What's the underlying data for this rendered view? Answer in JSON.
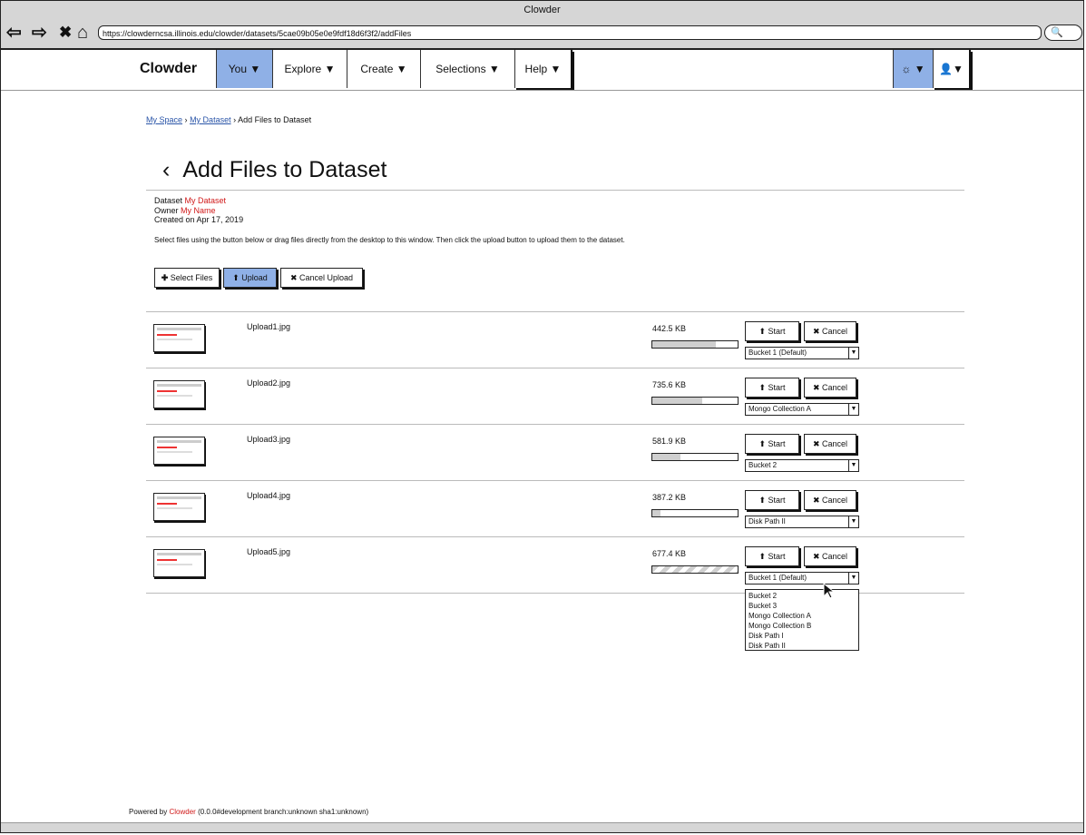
{
  "window": {
    "title": "Clowder"
  },
  "browser": {
    "url": "https://clowderncsa.illinois.edu/clowder/datasets/5cae09b05e0e9fdf18d6f3f2/addFiles",
    "search_icon": "search-icon"
  },
  "navbar": {
    "brand": "Clowder",
    "menus": [
      {
        "label": "You ▼"
      },
      {
        "label": "Explore ▼"
      },
      {
        "label": "Create ▼"
      },
      {
        "label": "Selections ▼"
      },
      {
        "label": "Help ▼"
      }
    ],
    "right_items": [
      {
        "label": "☼ ▼"
      },
      {
        "label": "👤▼"
      }
    ],
    "accent_color": "#8fb0e6"
  },
  "breadcrumb": {
    "items": [
      "My Space",
      "My Dataset"
    ],
    "separator": "›",
    "current": "Add Files to Dataset"
  },
  "page": {
    "back_icon": "‹",
    "title": "Add Files to Dataset",
    "dataset_label": "Dataset",
    "dataset_value": "My Dataset",
    "owner_label": "Owner",
    "owner_value": "My Name",
    "created": "Created on Apr 17, 2019",
    "instructions": "Select files using the button below or drag files directly from the desktop to this window. Then click the upload button to upload them to the dataset."
  },
  "toolbar": {
    "select_files": "Select Files",
    "upload": "Upload",
    "cancel_upload": "Cancel Upload"
  },
  "files": [
    {
      "name": "Upload1.jpg",
      "size": "442.5 KB",
      "progress": 0.74,
      "start": "Start",
      "cancel": "Cancel",
      "storage": "Bucket 1 (Default)"
    },
    {
      "name": "Upload2.jpg",
      "size": "735.6 KB",
      "progress": 0.59,
      "start": "Start",
      "cancel": "Cancel",
      "storage": "Mongo Collection A"
    },
    {
      "name": "Upload3.jpg",
      "size": "581.9 KB",
      "progress": 0.33,
      "start": "Start",
      "cancel": "Cancel",
      "storage": "Bucket 2"
    },
    {
      "name": "Upload4.jpg",
      "size": "387.2 KB",
      "progress": 0.1,
      "start": "Start",
      "cancel": "Cancel",
      "storage": "Disk Path II"
    },
    {
      "name": "Upload5.jpg",
      "size": "677.4 KB",
      "progress": 1.0,
      "start": "Start",
      "cancel": "Cancel",
      "storage": "Bucket 1 (Default)"
    }
  ],
  "dropdown_options": [
    "Bucket 2",
    "Bucket 3",
    "Mongo Collection A",
    "Mongo Collection B",
    "Disk Path I",
    "Disk Path II"
  ],
  "footer": {
    "prefix": "Powered by",
    "brand": "Clowder",
    "suffix": "(0.0.0#development branch:unknown sha1:unknown)"
  }
}
